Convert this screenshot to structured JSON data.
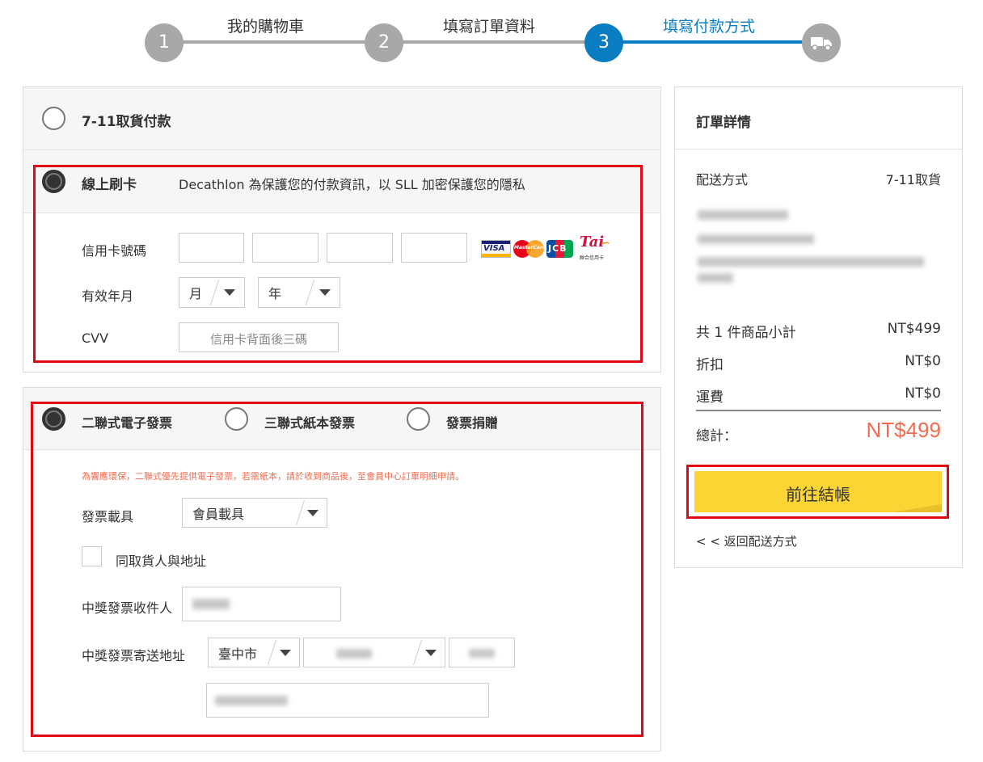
{
  "steps": [
    {
      "number": "1",
      "label": "我的購物車",
      "state": "done"
    },
    {
      "number": "2",
      "label": "填寫訂單資料",
      "state": "done"
    },
    {
      "number": "3",
      "label": "填寫付款方式",
      "state": "active"
    },
    {
      "icon": "truck-icon",
      "state": "upcoming"
    }
  ],
  "colors": {
    "active": "#0a7cc1",
    "inactive": "#a8a8a8",
    "price": "#f26b4f",
    "checkout": "#fbd534",
    "notice": "#f26b4f",
    "highlight": "#e30613"
  },
  "payment": {
    "option_711_label": "7-11取貨付款",
    "option_card_label": "線上刷卡",
    "card_notice": "Decathlon 為保護您的付款資訊，以 SLL 加密保護您的隱私",
    "card_number_label": "信用卡號碼",
    "expiry_label": "有效年月",
    "month_value": "月",
    "year_value": "年",
    "cvv_label": "CVV",
    "cvv_placeholder": "信用卡背面後三碼",
    "card_logos": [
      "VISA",
      "MasterCard",
      "JCB",
      "聯合信用卡"
    ]
  },
  "invoice": {
    "option_e_invoice": "二聯式電子發票",
    "option_paper_invoice": "三聯式紙本發票",
    "option_donate": "發票捐贈",
    "notice": "為響應環保，二聯式優先提供電子發票，若需紙本，請於收到商品後，至會員中心訂單明細申請。",
    "carrier_label": "發票載具",
    "carrier_value": "會員載具",
    "same_as_recipient_label": "同取貨人與地址",
    "winner_name_label": "中獎發票收件人",
    "winner_address_label": "中獎發票寄送地址",
    "city_value": "臺中市"
  },
  "summary": {
    "title": "訂單詳情",
    "shipping_label": "配送方式",
    "shipping_value": "7-11取貨",
    "subtotal_label": "共 1 件商品小計",
    "subtotal_value": "NT$499",
    "discount_label": "折扣",
    "discount_value": "NT$0",
    "freight_label": "運費",
    "freight_value": "NT$0",
    "total_label": "總計：",
    "total_value": "NT$499",
    "checkout_button": "前往結帳",
    "back_link": "< < 返回配送方式"
  }
}
